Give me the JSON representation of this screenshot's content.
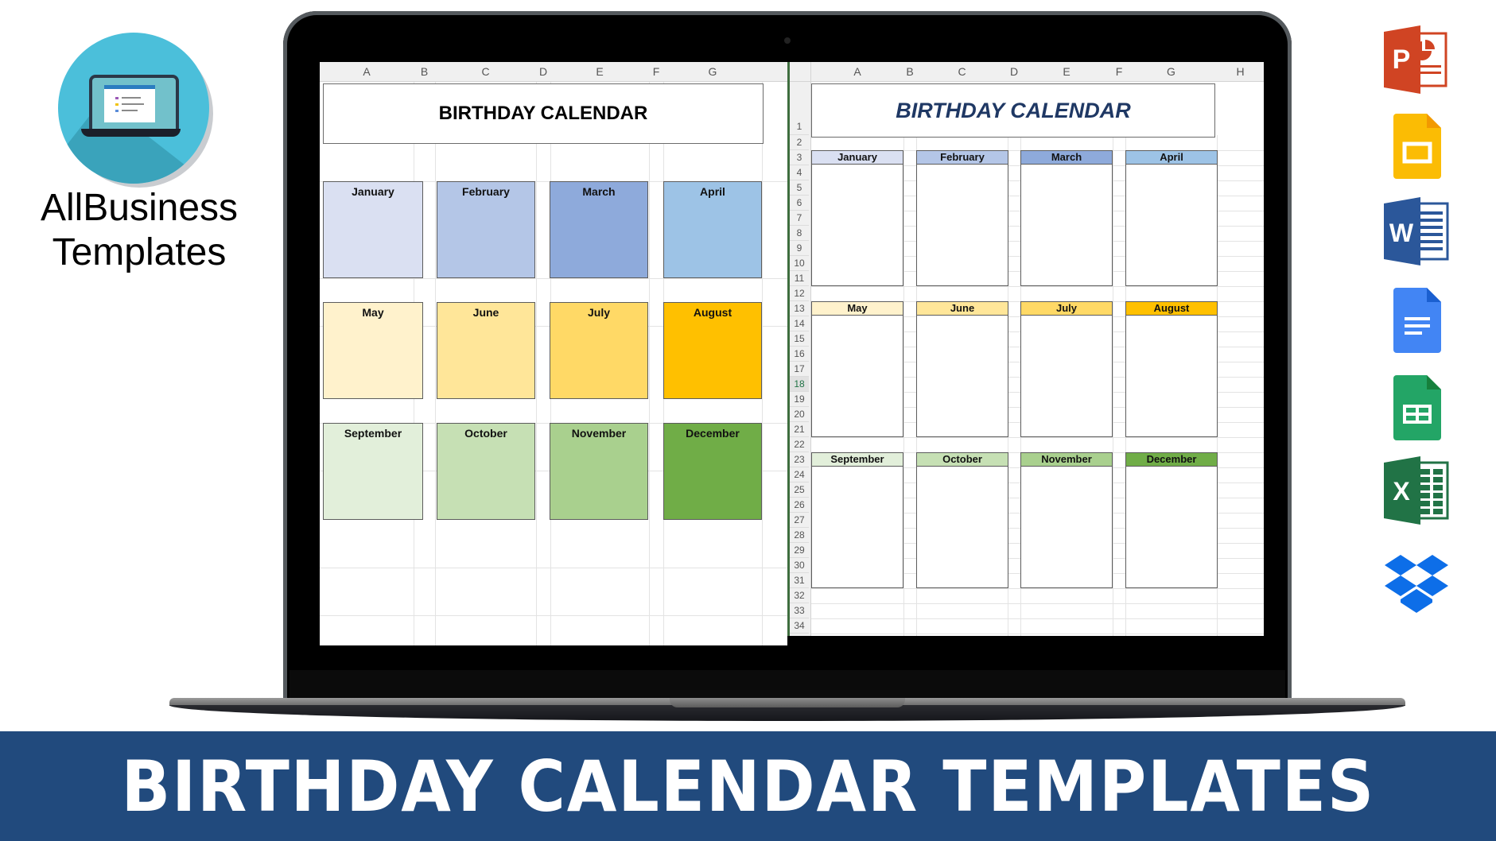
{
  "brand": {
    "logo_line1": "AllBusiness",
    "logo_line2": "Templates",
    "logo_icon": "laptop-icon"
  },
  "banner": {
    "title": "BIRTHDAY CALENDAR TEMPLATES",
    "background": "#214a7d"
  },
  "left_sheet": {
    "columns": [
      "A",
      "B",
      "C",
      "D",
      "E",
      "F",
      "G"
    ],
    "title": "BIRTHDAY CALENDAR",
    "months": [
      {
        "name": "January",
        "color": "#dae0f2"
      },
      {
        "name": "February",
        "color": "#b4c6e7"
      },
      {
        "name": "March",
        "color": "#8eaadb"
      },
      {
        "name": "April",
        "color": "#9dc3e6"
      },
      {
        "name": "May",
        "color": "#fff2cc"
      },
      {
        "name": "June",
        "color": "#ffe699"
      },
      {
        "name": "July",
        "color": "#ffd966"
      },
      {
        "name": "August",
        "color": "#ffc000"
      },
      {
        "name": "September",
        "color": "#e2efda"
      },
      {
        "name": "October",
        "color": "#c6e0b4"
      },
      {
        "name": "November",
        "color": "#a9d08e"
      },
      {
        "name": "December",
        "color": "#70ad47"
      }
    ]
  },
  "right_sheet": {
    "columns": [
      "A",
      "B",
      "C",
      "D",
      "E",
      "F",
      "G",
      "H"
    ],
    "title": "BIRTHDAY CALENDAR",
    "title_color": "#1f3864",
    "selected_row": "18",
    "rows": [
      "1",
      "2",
      "3",
      "4",
      "5",
      "6",
      "7",
      "8",
      "9",
      "10",
      "11",
      "12",
      "13",
      "14",
      "15",
      "16",
      "17",
      "18",
      "19",
      "20",
      "21",
      "22",
      "23",
      "24",
      "25",
      "26",
      "27",
      "28",
      "29",
      "30",
      "31",
      "32",
      "33",
      "34"
    ],
    "months": [
      {
        "name": "January",
        "color": "#dae0f2"
      },
      {
        "name": "February",
        "color": "#b4c6e7"
      },
      {
        "name": "March",
        "color": "#8eaadb"
      },
      {
        "name": "April",
        "color": "#9dc3e6"
      },
      {
        "name": "May",
        "color": "#fff2cc"
      },
      {
        "name": "June",
        "color": "#ffe699"
      },
      {
        "name": "July",
        "color": "#ffd966"
      },
      {
        "name": "August",
        "color": "#ffc000"
      },
      {
        "name": "September",
        "color": "#e2efda"
      },
      {
        "name": "October",
        "color": "#c6e0b4"
      },
      {
        "name": "November",
        "color": "#a9d08e"
      },
      {
        "name": "December",
        "color": "#70ad47"
      }
    ],
    "entry_rows_per_month": 8
  },
  "app_icons": [
    {
      "name": "powerpoint-icon",
      "letter": "P",
      "color": "#d04423"
    },
    {
      "name": "google-slides-icon",
      "letter": "",
      "color": "#fbbc04"
    },
    {
      "name": "word-icon",
      "letter": "W",
      "color": "#2b579a"
    },
    {
      "name": "google-docs-icon",
      "letter": "",
      "color": "#4285f4"
    },
    {
      "name": "google-sheets-icon",
      "letter": "",
      "color": "#23a566"
    },
    {
      "name": "excel-icon",
      "letter": "X",
      "color": "#217346"
    },
    {
      "name": "dropbox-icon",
      "letter": "",
      "color": "#0d6ee8"
    }
  ]
}
